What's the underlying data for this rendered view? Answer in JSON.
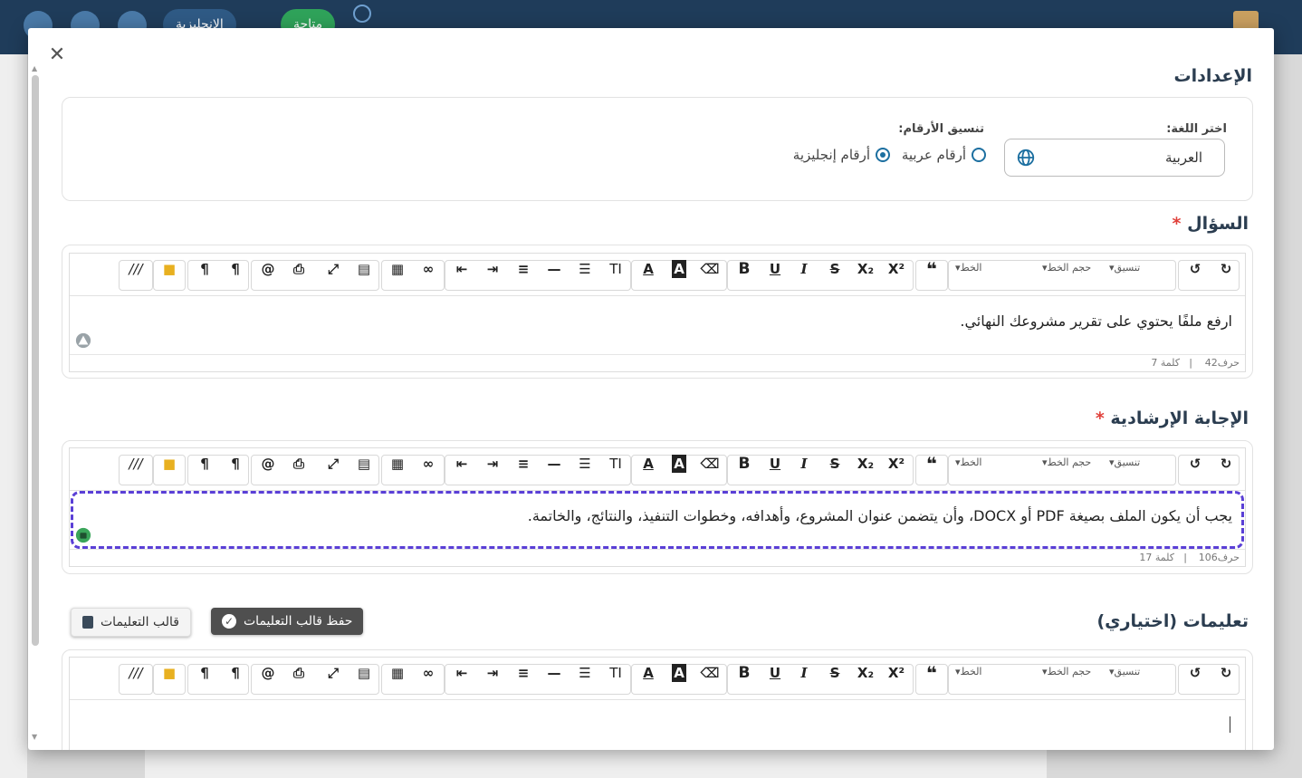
{
  "topbar": {
    "english_label": "الإنجليزية",
    "available_label": "متاحة"
  },
  "modal": {
    "title": "الإعدادات",
    "settings": {
      "language_label": "اختر اللغة:",
      "language_value": "العربية",
      "number_format_label": "تنسيق الأرقام:",
      "option_arabic": "أرقام عربية",
      "option_english": "أرقام إنجليزية",
      "selected": "أرقام إنجليزية"
    },
    "question": {
      "label": "السؤال",
      "required_mark": "*",
      "text": "ارفع ملفًا يحتوي على تقرير مشروعك النهائي.",
      "chars": "حرف42",
      "words": "كلمة 7"
    },
    "guide_answer": {
      "label": "الإجابة الإرشادية",
      "required_mark": "*",
      "text": "يجب أن يكون الملف بصيغة PDF أو DOCX، وأن يتضمن عنوان المشروع، وأهدافه، وخطوات التنفيذ، والنتائج، والخاتمة.",
      "chars": "حرف106",
      "words": "كلمة 17"
    },
    "instructions": {
      "label": "تعليمات (اختياري)",
      "save_template_button": "حفظ قالب التعليمات",
      "template_button": "قالب التعليمات"
    },
    "toolbar": {
      "format_label": "تنسيق",
      "font_size_label": "حجم الخط",
      "font_label": "الخط"
    }
  },
  "colors": {
    "accent": "#1c6fa0",
    "heading": "#2b3d50",
    "dashed_border": "#5a3fd6",
    "topbar": "#1f3c5a"
  }
}
